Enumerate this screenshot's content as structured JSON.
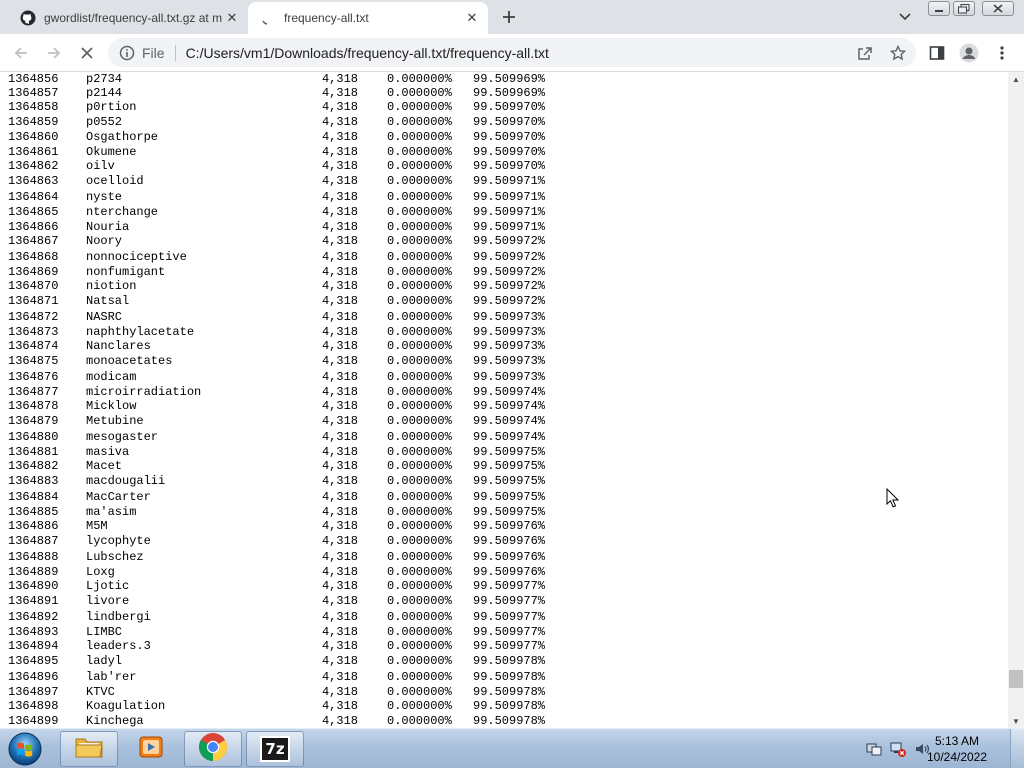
{
  "tabs": [
    {
      "title": "gwordlist/frequency-all.txt.gz at m",
      "icon": "github-icon",
      "active": false
    },
    {
      "title": "frequency-all.txt",
      "icon": "loading-icon",
      "active": true
    }
  ],
  "toolbar": {
    "scheme": "File",
    "url": "C:/Users/vm1/Downloads/frequency-all.txt/frequency-all.txt"
  },
  "rows": [
    {
      "id": "1364856",
      "word": "p2734",
      "count": "4,318",
      "pct": "0.000000%",
      "cum": "99.509969%"
    },
    {
      "id": "1364857",
      "word": "p2144",
      "count": "4,318",
      "pct": "0.000000%",
      "cum": "99.509969%"
    },
    {
      "id": "1364858",
      "word": "p0rtion",
      "count": "4,318",
      "pct": "0.000000%",
      "cum": "99.509970%"
    },
    {
      "id": "1364859",
      "word": "p0552",
      "count": "4,318",
      "pct": "0.000000%",
      "cum": "99.509970%"
    },
    {
      "id": "1364860",
      "word": "Osgathorpe",
      "count": "4,318",
      "pct": "0.000000%",
      "cum": "99.509970%"
    },
    {
      "id": "1364861",
      "word": "Okumene",
      "count": "4,318",
      "pct": "0.000000%",
      "cum": "99.509970%"
    },
    {
      "id": "1364862",
      "word": "oilv",
      "count": "4,318",
      "pct": "0.000000%",
      "cum": "99.509970%"
    },
    {
      "id": "1364863",
      "word": "ocelloid",
      "count": "4,318",
      "pct": "0.000000%",
      "cum": "99.509971%"
    },
    {
      "id": "1364864",
      "word": "nyste",
      "count": "4,318",
      "pct": "0.000000%",
      "cum": "99.509971%"
    },
    {
      "id": "1364865",
      "word": "nterchange",
      "count": "4,318",
      "pct": "0.000000%",
      "cum": "99.509971%"
    },
    {
      "id": "1364866",
      "word": "Nouria",
      "count": "4,318",
      "pct": "0.000000%",
      "cum": "99.509971%"
    },
    {
      "id": "1364867",
      "word": "Noory",
      "count": "4,318",
      "pct": "0.000000%",
      "cum": "99.509972%"
    },
    {
      "id": "1364868",
      "word": "nonnociceptive",
      "count": "4,318",
      "pct": "0.000000%",
      "cum": "99.509972%"
    },
    {
      "id": "1364869",
      "word": "nonfumigant",
      "count": "4,318",
      "pct": "0.000000%",
      "cum": "99.509972%"
    },
    {
      "id": "1364870",
      "word": "niotion",
      "count": "4,318",
      "pct": "0.000000%",
      "cum": "99.509972%"
    },
    {
      "id": "1364871",
      "word": "Natsal",
      "count": "4,318",
      "pct": "0.000000%",
      "cum": "99.509972%"
    },
    {
      "id": "1364872",
      "word": "NASRC",
      "count": "4,318",
      "pct": "0.000000%",
      "cum": "99.509973%"
    },
    {
      "id": "1364873",
      "word": "naphthylacetate",
      "count": "4,318",
      "pct": "0.000000%",
      "cum": "99.509973%"
    },
    {
      "id": "1364874",
      "word": "Nanclares",
      "count": "4,318",
      "pct": "0.000000%",
      "cum": "99.509973%"
    },
    {
      "id": "1364875",
      "word": "monoacetates",
      "count": "4,318",
      "pct": "0.000000%",
      "cum": "99.509973%"
    },
    {
      "id": "1364876",
      "word": "modicam",
      "count": "4,318",
      "pct": "0.000000%",
      "cum": "99.509973%"
    },
    {
      "id": "1364877",
      "word": "microirradiation",
      "count": "4,318",
      "pct": "0.000000%",
      "cum": "99.509974%"
    },
    {
      "id": "1364878",
      "word": "Micklow",
      "count": "4,318",
      "pct": "0.000000%",
      "cum": "99.509974%"
    },
    {
      "id": "1364879",
      "word": "Metubine",
      "count": "4,318",
      "pct": "0.000000%",
      "cum": "99.509974%"
    },
    {
      "id": "1364880",
      "word": "mesogaster",
      "count": "4,318",
      "pct": "0.000000%",
      "cum": "99.509974%"
    },
    {
      "id": "1364881",
      "word": "masiva",
      "count": "4,318",
      "pct": "0.000000%",
      "cum": "99.509975%"
    },
    {
      "id": "1364882",
      "word": "Macet",
      "count": "4,318",
      "pct": "0.000000%",
      "cum": "99.509975%"
    },
    {
      "id": "1364883",
      "word": "macdougalii",
      "count": "4,318",
      "pct": "0.000000%",
      "cum": "99.509975%"
    },
    {
      "id": "1364884",
      "word": "MacCarter",
      "count": "4,318",
      "pct": "0.000000%",
      "cum": "99.509975%"
    },
    {
      "id": "1364885",
      "word": "ma'asim",
      "count": "4,318",
      "pct": "0.000000%",
      "cum": "99.509975%"
    },
    {
      "id": "1364886",
      "word": "M5M",
      "count": "4,318",
      "pct": "0.000000%",
      "cum": "99.509976%"
    },
    {
      "id": "1364887",
      "word": "lycophyte",
      "count": "4,318",
      "pct": "0.000000%",
      "cum": "99.509976%"
    },
    {
      "id": "1364888",
      "word": "Lubschez",
      "count": "4,318",
      "pct": "0.000000%",
      "cum": "99.509976%"
    },
    {
      "id": "1364889",
      "word": "Loxg",
      "count": "4,318",
      "pct": "0.000000%",
      "cum": "99.509976%"
    },
    {
      "id": "1364890",
      "word": "Ljotic",
      "count": "4,318",
      "pct": "0.000000%",
      "cum": "99.509977%"
    },
    {
      "id": "1364891",
      "word": "livore",
      "count": "4,318",
      "pct": "0.000000%",
      "cum": "99.509977%"
    },
    {
      "id": "1364892",
      "word": "lindbergi",
      "count": "4,318",
      "pct": "0.000000%",
      "cum": "99.509977%"
    },
    {
      "id": "1364893",
      "word": "LIMBC",
      "count": "4,318",
      "pct": "0.000000%",
      "cum": "99.509977%"
    },
    {
      "id": "1364894",
      "word": "leaders.3",
      "count": "4,318",
      "pct": "0.000000%",
      "cum": "99.509977%"
    },
    {
      "id": "1364895",
      "word": "ladyl",
      "count": "4,318",
      "pct": "0.000000%",
      "cum": "99.509978%"
    },
    {
      "id": "1364896",
      "word": "lab'rer",
      "count": "4,318",
      "pct": "0.000000%",
      "cum": "99.509978%"
    },
    {
      "id": "1364897",
      "word": "KTVC",
      "count": "4,318",
      "pct": "0.000000%",
      "cum": "99.509978%"
    },
    {
      "id": "1364898",
      "word": "Koagulation",
      "count": "4,318",
      "pct": "0.000000%",
      "cum": "99.509978%"
    },
    {
      "id": "1364899",
      "word": "Kinchega",
      "count": "4,318",
      "pct": "0.000000%",
      "cum": "99.509978%"
    }
  ],
  "taskbar": {
    "apps": [
      {
        "name": "windows-explorer",
        "icon": "folder-icon"
      },
      {
        "name": "windows-media-player",
        "icon": "media-player-icon"
      },
      {
        "name": "google-chrome",
        "icon": "chrome-icon"
      },
      {
        "name": "7-zip",
        "icon": "7zip-icon",
        "label": "7z"
      }
    ],
    "time": "5:13 AM",
    "date": "10/24/2022"
  }
}
